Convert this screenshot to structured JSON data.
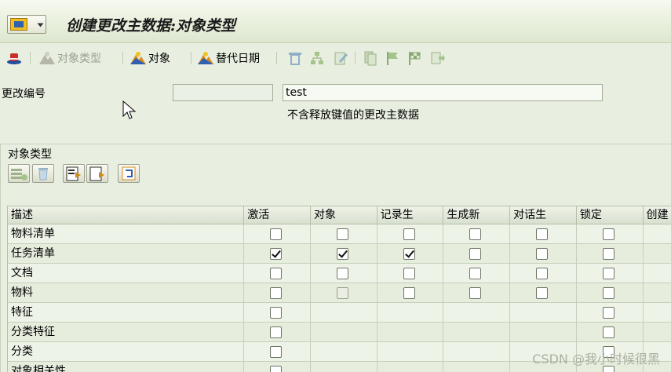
{
  "window": {
    "title": "创建更改主数据:对象类型"
  },
  "toolbar": {
    "object_type_label": "对象类型",
    "object_label": "对象",
    "alt_date_label": "替代日期"
  },
  "form": {
    "change_number_label": "更改编号",
    "change_number_value": "",
    "description_value": "test",
    "note": "不含释放键值的更改主数据"
  },
  "group": {
    "title": "对象类型"
  },
  "table": {
    "columns": [
      "描述",
      "激活",
      "对象",
      "记录生",
      "生成新",
      "对话生",
      "锁定",
      "创建"
    ],
    "rows": [
      {
        "label": "物料清单",
        "cells": [
          "off",
          "off",
          "off",
          "off",
          "off",
          "off"
        ]
      },
      {
        "label": "任务清单",
        "cells": [
          "on",
          "on",
          "on",
          "off",
          "off",
          "off"
        ]
      },
      {
        "label": "文档",
        "cells": [
          "off",
          "off",
          "off",
          "off",
          "off",
          "off"
        ]
      },
      {
        "label": "物料",
        "cells": [
          "off",
          "disabled",
          "off",
          "off",
          "off",
          "off"
        ]
      },
      {
        "label": "特征",
        "cells": [
          "off",
          "none",
          "none",
          "none",
          "none",
          "off"
        ]
      },
      {
        "label": "分类特征",
        "cells": [
          "off",
          "none",
          "none",
          "none",
          "none",
          "off"
        ]
      },
      {
        "label": "分类",
        "cells": [
          "off",
          "none",
          "none",
          "none",
          "none",
          "off"
        ]
      },
      {
        "label": "对象相关性",
        "cells": [
          "off",
          "none",
          "none",
          "none",
          "none",
          "off"
        ]
      }
    ]
  },
  "watermark": "CSDN @我小时候很黑",
  "colors": {
    "background": "#e8efe0",
    "accent": "#3060b0"
  }
}
